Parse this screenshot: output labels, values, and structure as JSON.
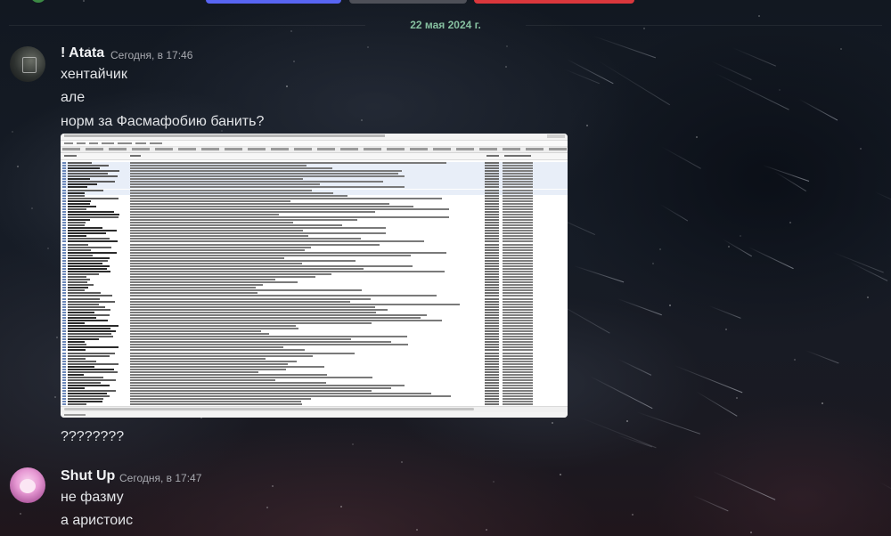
{
  "colors": {
    "accent_blue": "#5865f2",
    "danger_red": "#da373c",
    "neutral_gray": "#4e5058",
    "date_divider_text": "#86c0a0"
  },
  "date_divider": "22 мая 2024 г.",
  "messages": [
    {
      "username": "! Atata",
      "timestamp": "Сегодня, в 17:46",
      "lines": [
        "хентайчик",
        "але",
        "норм за Фасмафобию банить?"
      ],
      "attachment": {
        "type": "image",
        "description_icon": "file-search-screenshot"
      },
      "after_attachment": "????????"
    },
    {
      "username": "Shut Up",
      "timestamp": "Сегодня, в 17:47",
      "lines": [
        "не фазму",
        "а аристоис"
      ]
    }
  ]
}
